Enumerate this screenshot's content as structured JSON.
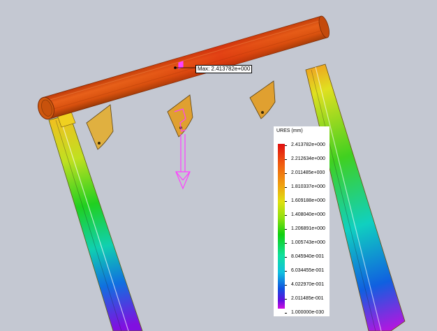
{
  "probe": {
    "max_label": "Max: 2.413782e+000"
  },
  "legend": {
    "title": "URES (mm)",
    "labels": [
      "2.413782e+000",
      "2.212634e+000",
      "2.011485e+000",
      "1.810337e+000",
      "1.609188e+000",
      "1.408040e+000",
      "1.206891e+000",
      "1.005743e+000",
      "8.045940e-001",
      "6.034455e-001",
      "4.022970e-001",
      "2.011485e-001",
      "1.000000e-030"
    ]
  },
  "colors": {
    "background": "#c4c8d2",
    "max_color": "#e01010",
    "min_color": "#d010e0",
    "load_arrow": "#ff40ff"
  }
}
